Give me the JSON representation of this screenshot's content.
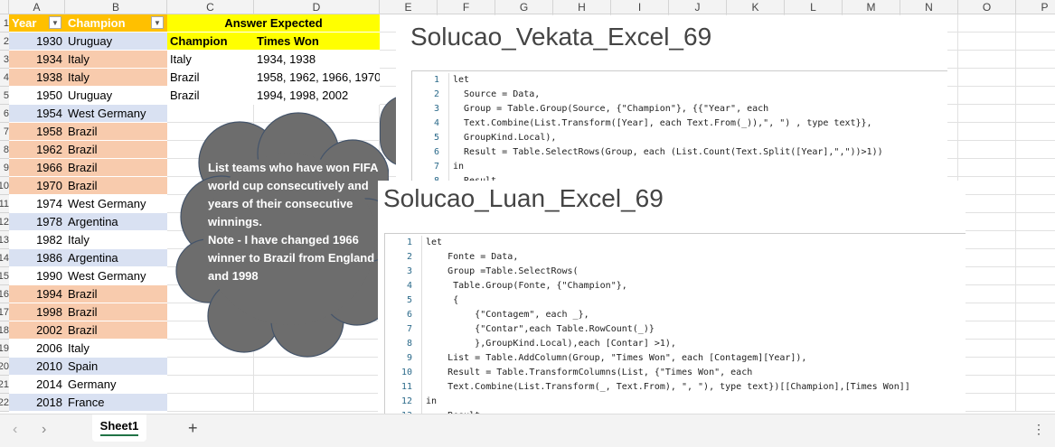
{
  "columns": [
    "A",
    "B",
    "C",
    "D",
    "E",
    "F",
    "G",
    "H",
    "I",
    "J",
    "K",
    "L",
    "M",
    "N",
    "O",
    "P"
  ],
  "table": {
    "headers": [
      "Year",
      "Champion"
    ],
    "rows": [
      {
        "year": "1930",
        "champion": "Uruguay",
        "fill": "#D9E1F2"
      },
      {
        "year": "1934",
        "champion": "Italy",
        "fill": "#F8CBAD"
      },
      {
        "year": "1938",
        "champion": "Italy",
        "fill": "#F8CBAD"
      },
      {
        "year": "1950",
        "champion": "Uruguay",
        "fill": "#FFFFFF"
      },
      {
        "year": "1954",
        "champion": "West Germany",
        "fill": "#D9E1F2"
      },
      {
        "year": "1958",
        "champion": "Brazil",
        "fill": "#F8CBAD"
      },
      {
        "year": "1962",
        "champion": "Brazil",
        "fill": "#F8CBAD"
      },
      {
        "year": "1966",
        "champion": "Brazil",
        "fill": "#F8CBAD"
      },
      {
        "year": "1970",
        "champion": "Brazil",
        "fill": "#F8CBAD"
      },
      {
        "year": "1974",
        "champion": "West Germany",
        "fill": "#FFFFFF"
      },
      {
        "year": "1978",
        "champion": "Argentina",
        "fill": "#D9E1F2"
      },
      {
        "year": "1982",
        "champion": "Italy",
        "fill": "#FFFFFF"
      },
      {
        "year": "1986",
        "champion": "Argentina",
        "fill": "#D9E1F2"
      },
      {
        "year": "1990",
        "champion": "West Germany",
        "fill": "#FFFFFF"
      },
      {
        "year": "1994",
        "champion": "Brazil",
        "fill": "#F8CBAD"
      },
      {
        "year": "1998",
        "champion": "Brazil",
        "fill": "#F8CBAD"
      },
      {
        "year": "2002",
        "champion": "Brazil",
        "fill": "#F8CBAD"
      },
      {
        "year": "2006",
        "champion": "Italy",
        "fill": "#FFFFFF"
      },
      {
        "year": "2010",
        "champion": "Spain",
        "fill": "#D9E1F2"
      },
      {
        "year": "2014",
        "champion": "Germany",
        "fill": "#FFFFFF"
      },
      {
        "year": "2018",
        "champion": "France",
        "fill": "#D9E1F2"
      }
    ]
  },
  "answer": {
    "title": "Answer Expected",
    "headers": [
      "Champion",
      "Times Won"
    ],
    "rows": [
      [
        "Italy",
        "1934, 1938"
      ],
      [
        "Brazil",
        "1958, 1962, 1966, 1970"
      ],
      [
        "Brazil",
        "1994, 1998, 2002"
      ]
    ]
  },
  "callout": "List teams who have won FIFA world cup consecutively and years of their consecutive winnings.\nNote - I have changed 1966 winner to Brazil from England and 1998",
  "solution1": {
    "title": "Solucao_Vekata_Excel_69",
    "lines": [
      "let",
      "  Source = Data,",
      "  Group = Table.Group(Source, {\"Champion\"}, {{\"Year\", each",
      "  Text.Combine(List.Transform([Year], each Text.From(_)),\", \") , type text}},",
      "  GroupKind.Local),",
      "  Result = Table.SelectRows(Group, each (List.Count(Text.Split([Year],\",\"))>1))",
      "in",
      "  Result"
    ]
  },
  "solution2": {
    "title": "Solucao_Luan_Excel_69",
    "lines": [
      "let",
      "    Fonte = Data,",
      "    Group =Table.SelectRows(",
      "     Table.Group(Fonte, {\"Champion\"},",
      "     {",
      "         {\"Contagem\", each _},",
      "         {\"Contar\",each Table.RowCount(_)}",
      "         },GroupKind.Local),each [Contar] >1),",
      "    List = Table.AddColumn(Group, \"Times Won\", each [Contagem][Year]),",
      "    Result = Table.TransformColumns(List, {\"Times Won\", each",
      "    Text.Combine(List.Transform(_, Text.From), \", \"), type text})[[Champion],[Times Won]]",
      "in",
      "    Result"
    ]
  },
  "sheet_tabs": [
    "Sheet1"
  ],
  "icons": {
    "prev": "chevron-left-icon",
    "next": "chevron-right-icon",
    "add": "plus-icon",
    "more": "more-vertical-icon"
  }
}
